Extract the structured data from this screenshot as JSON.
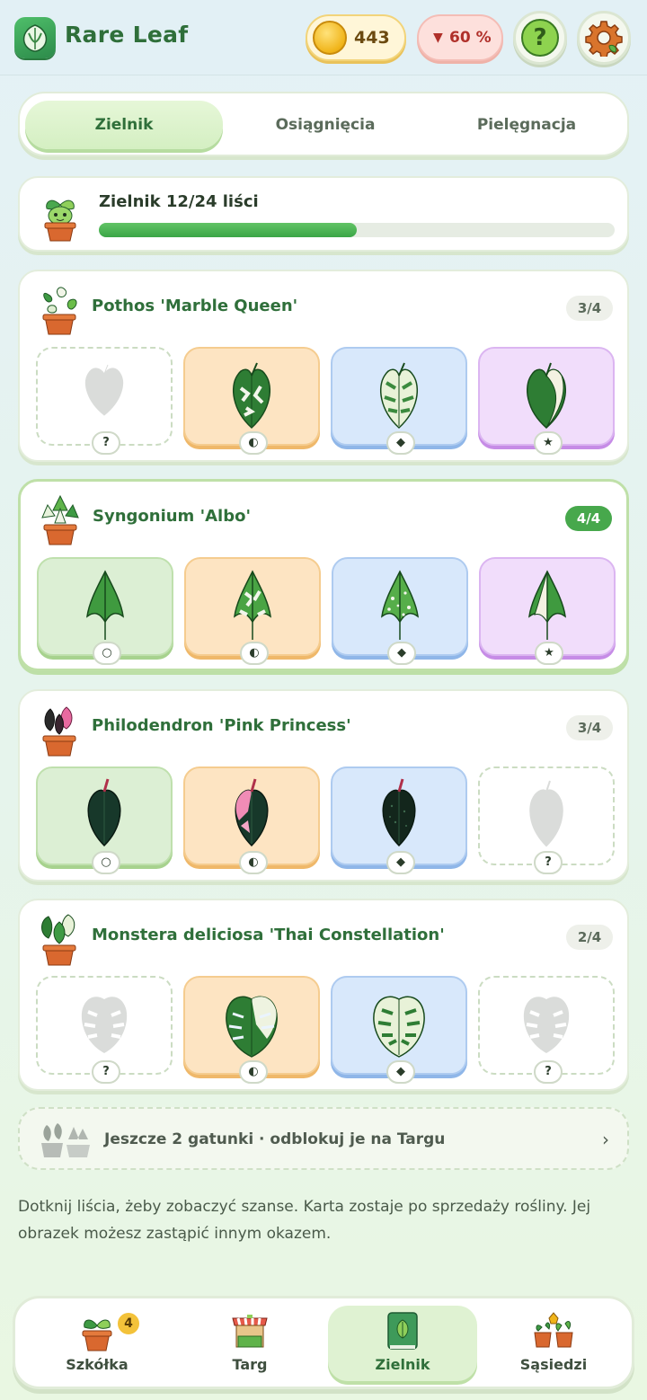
{
  "app": {
    "title": "Rare Leaf"
  },
  "header": {
    "coins": "443",
    "mood": "60 %",
    "help_icon": "?"
  },
  "tabs": [
    {
      "label": "Zielnik",
      "active": true
    },
    {
      "label": "Osiągnięcia",
      "active": false
    },
    {
      "label": "Pielęgnacja",
      "active": false
    }
  ],
  "progress": {
    "label": "Zielnik 12/24 liści",
    "collected": 12,
    "total": 24
  },
  "species": [
    {
      "name": "Pothos 'Marble Queen'",
      "count": "3/4",
      "complete": false,
      "slots": [
        {
          "rarity": "locked",
          "badge": "?"
        },
        {
          "rarity": "half",
          "badge": "◐"
        },
        {
          "rarity": "rare",
          "badge": "◆"
        },
        {
          "rarity": "epic",
          "badge": "★"
        }
      ]
    },
    {
      "name": "Syngonium 'Albo'",
      "count": "4/4",
      "complete": true,
      "slots": [
        {
          "rarity": "common",
          "badge": "○"
        },
        {
          "rarity": "half",
          "badge": "◐"
        },
        {
          "rarity": "rare",
          "badge": "◆"
        },
        {
          "rarity": "epic",
          "badge": "★"
        }
      ]
    },
    {
      "name": "Philodendron 'Pink Princess'",
      "count": "3/4",
      "complete": false,
      "slots": [
        {
          "rarity": "common",
          "badge": "○"
        },
        {
          "rarity": "half",
          "badge": "◐"
        },
        {
          "rarity": "rare",
          "badge": "◆"
        },
        {
          "rarity": "locked",
          "badge": "?"
        }
      ]
    },
    {
      "name": "Monstera deliciosa 'Thai Constellation'",
      "count": "2/4",
      "complete": false,
      "slots": [
        {
          "rarity": "locked",
          "badge": "?"
        },
        {
          "rarity": "half",
          "badge": "◐"
        },
        {
          "rarity": "rare",
          "badge": "◆"
        },
        {
          "rarity": "locked",
          "badge": "?"
        }
      ]
    }
  ],
  "unlock": {
    "text": "Jeszcze 2 gatunki · odblokuj je na Targu",
    "chevron": "›"
  },
  "hint": "Dotknij liścia, żeby zobaczyć szanse. Karta zostaje po sprzedaży rośliny. Jej obrazek możesz zastąpić innym okazem.",
  "nav": [
    {
      "label": "Szkółka",
      "badge": "4",
      "active": false
    },
    {
      "label": "Targ",
      "active": false
    },
    {
      "label": "Zielnik",
      "active": true
    },
    {
      "label": "Sąsiedzi",
      "active": false
    }
  ],
  "colors": {
    "accent": "#2f6f3a",
    "progress": "#3aa546",
    "coin": "#f0b419",
    "mood": "#b0302a"
  }
}
